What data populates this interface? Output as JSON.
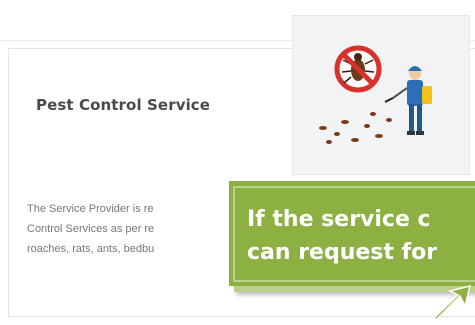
{
  "card": {
    "title": "Pest Control Service",
    "text_lines": [
      "The Service Provider is re",
      "Control Services as per re",
      "roaches, rats, ants, bedbu"
    ]
  },
  "illustration": {
    "icon": "no-bug-icon",
    "figure": "exterminator-spraying-icon"
  },
  "callout": {
    "lines": [
      "If the service c",
      "can request for"
    ],
    "color": "#8db043",
    "border_color": "#b8d38c"
  }
}
